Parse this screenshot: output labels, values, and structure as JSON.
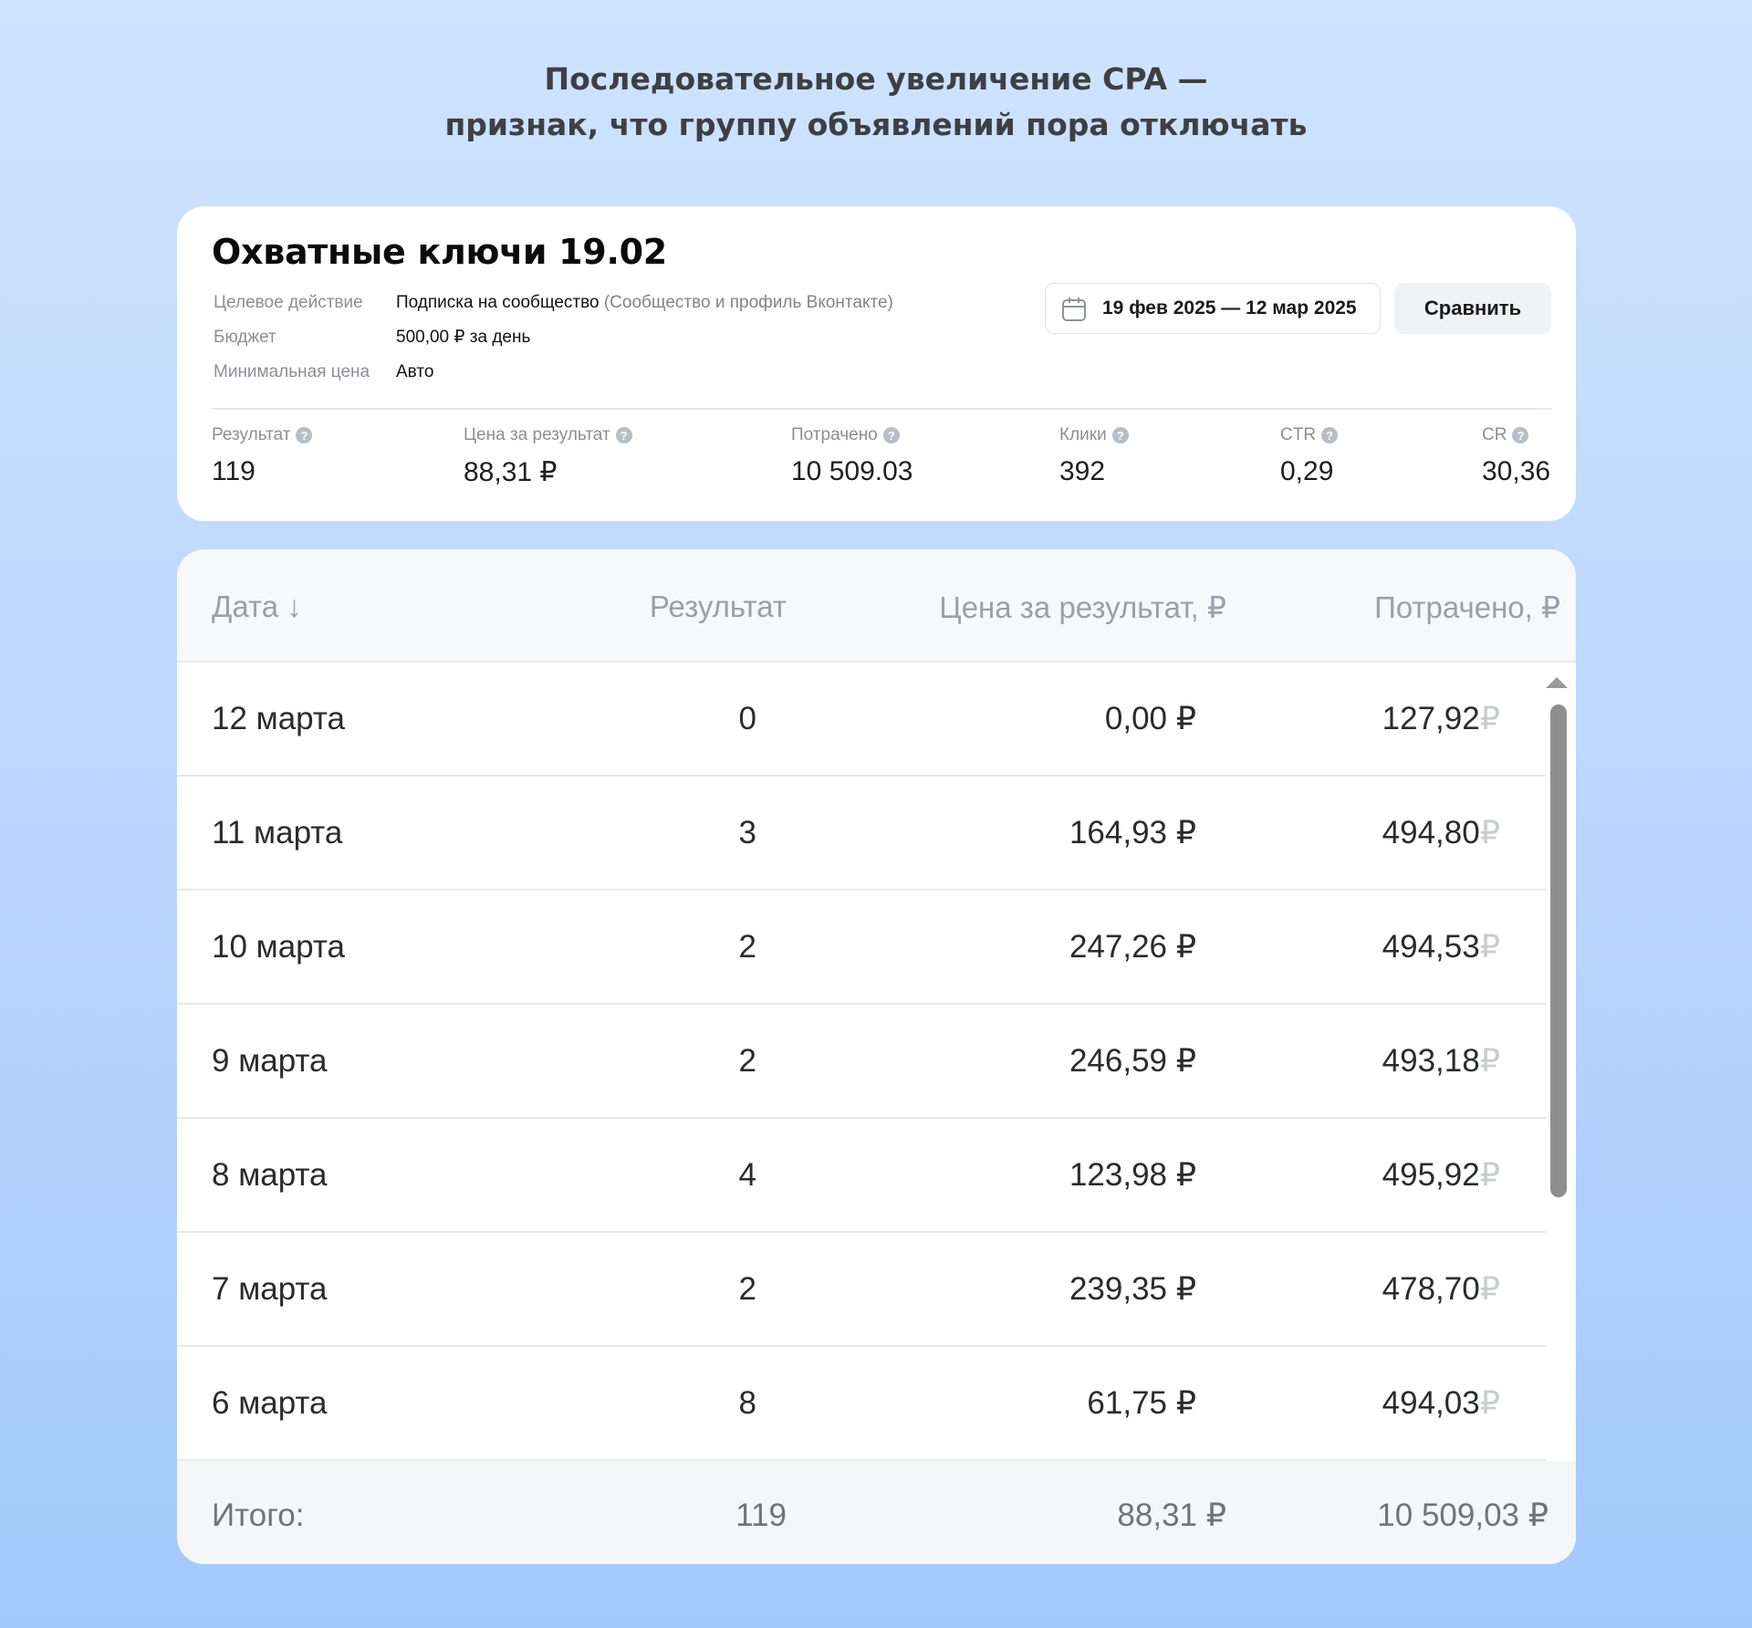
{
  "headline": {
    "line1": "Последовательное увеличение CPA —",
    "line2": "признак, что группу объявлений пора отключать"
  },
  "ad_group": {
    "title": "Охватные ключи 19.02",
    "meta": [
      {
        "label": "Целевое действие",
        "value": "Подписка на сообщество",
        "sub": " (Сообщество и профиль Вконтакте)"
      },
      {
        "label": "Бюджет",
        "value": "500,00 ₽ за день",
        "sub": ""
      },
      {
        "label": "Минимальная цена",
        "value": "Авто",
        "sub": ""
      }
    ],
    "date_range": "19 фев 2025 — 12 мар 2025",
    "compare_label": "Сравнить",
    "stats": [
      {
        "label": "Результат",
        "value": "119"
      },
      {
        "label": "Цена за результат",
        "value": "88,31 ₽"
      },
      {
        "label": "Потрачено",
        "value": "10 509.03"
      },
      {
        "label": "Клики",
        "value": "392"
      },
      {
        "label": "CTR",
        "value": "0,29"
      },
      {
        "label": "CR",
        "value": "30,36"
      }
    ],
    "help_glyph": "?"
  },
  "table": {
    "headers": {
      "date": "Дата ↓",
      "result": "Результат",
      "cpa": "Цена за результат, ₽",
      "spent": "Потрачено, ₽"
    },
    "rows": [
      {
        "date": "12 марта",
        "result": "0",
        "cpa": "0,00 ₽",
        "spent": "127,92"
      },
      {
        "date": "11 марта",
        "result": "3",
        "cpa": "164,93 ₽",
        "spent": "494,80"
      },
      {
        "date": "10 марта",
        "result": "2",
        "cpa": "247,26 ₽",
        "spent": "494,53"
      },
      {
        "date": "9 марта",
        "result": "2",
        "cpa": "246,59 ₽",
        "spent": "493,18"
      },
      {
        "date": "8 марта",
        "result": "4",
        "cpa": "123,98 ₽",
        "spent": "495,92"
      },
      {
        "date": "7 марта",
        "result": "2",
        "cpa": "239,35 ₽",
        "spent": "478,70"
      },
      {
        "date": "6 марта",
        "result": "8",
        "cpa": "61,75 ₽",
        "spent": "494,03"
      }
    ],
    "spent_cut_glyph": "₽",
    "totals": {
      "label": "Итого:",
      "result": "119",
      "cpa": "88,31 ₽",
      "spent": "10 509,03 ₽"
    }
  }
}
